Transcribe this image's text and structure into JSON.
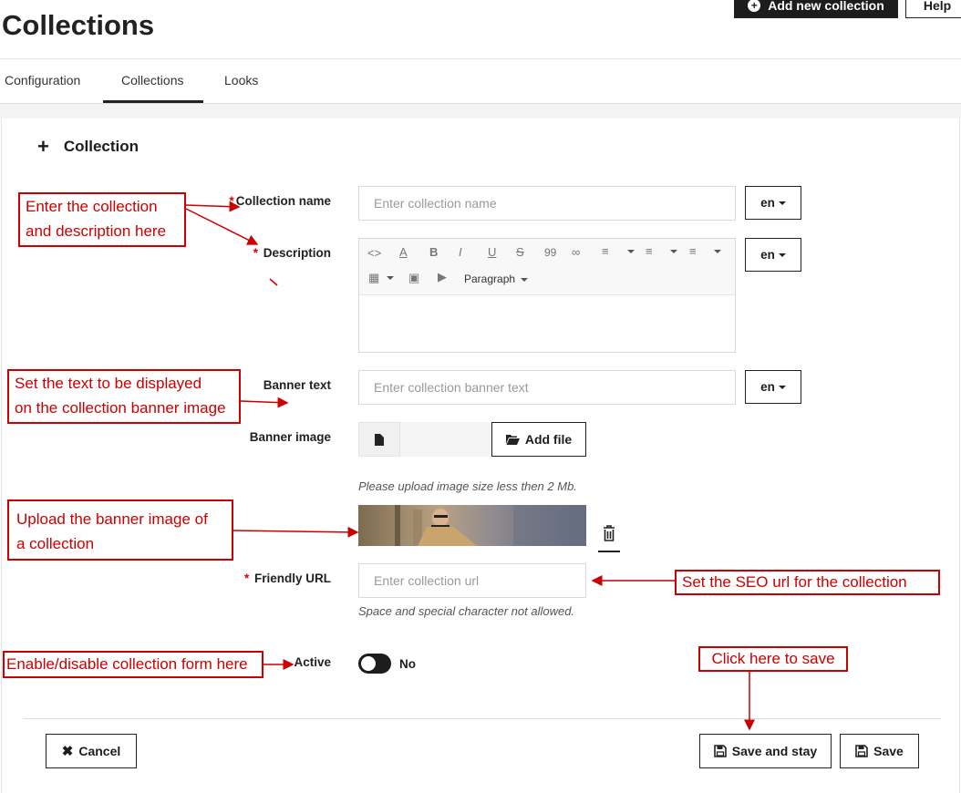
{
  "page": {
    "title": "Collections",
    "add_button": "Add new collection",
    "help_button": "Help"
  },
  "tabs": [
    {
      "label": "Configuration"
    },
    {
      "label": "Collections",
      "active": true
    },
    {
      "label": "Looks"
    }
  ],
  "section": {
    "title": "Collection"
  },
  "form": {
    "name": {
      "label": "Collection name",
      "placeholder": "Enter collection name",
      "lang": "en"
    },
    "description": {
      "label": "Description",
      "lang": "en",
      "block_format": "Paragraph"
    },
    "banner_text": {
      "label": "Banner text",
      "placeholder": "Enter collection banner text",
      "lang": "en"
    },
    "banner_image": {
      "label": "Banner image",
      "add_file": "Add file",
      "hint": "Please upload image size less then 2 Mb."
    },
    "friendly_url": {
      "label": "Friendly URL",
      "placeholder": "Enter collection url",
      "hint": "Space and special character not allowed."
    },
    "active": {
      "label": "Active",
      "value": "No"
    }
  },
  "footer": {
    "cancel": "Cancel",
    "save_and_stay": "Save and stay",
    "save": "Save"
  },
  "annotations": {
    "name_desc": [
      "Enter the collection",
      "and description here"
    ],
    "banner_text": [
      "Set the text to be displayed",
      "on the collection banner image"
    ],
    "banner_image": [
      "Upload the banner image of",
      "a collection"
    ],
    "seo": "Set the SEO url for the collection",
    "active": "Enable/disable collection form here",
    "save": "Click here to save"
  },
  "colors": {
    "accent": "#1d1d1d",
    "annotation": "#cc0000",
    "required": "#dd0000"
  }
}
